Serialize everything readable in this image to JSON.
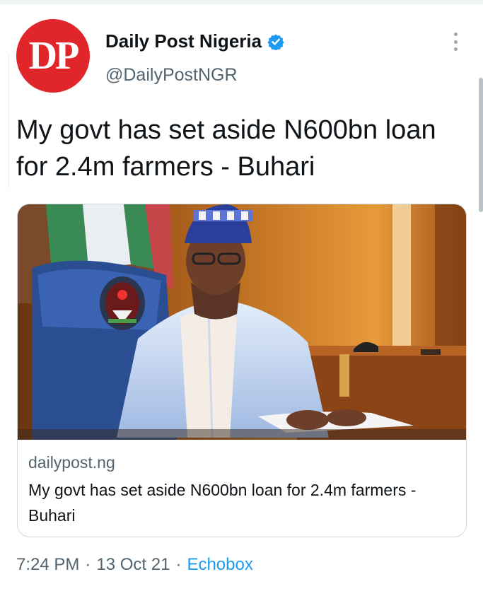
{
  "account": {
    "avatar_text": "DP",
    "display_name": "Daily Post Nigeria",
    "handle": "@DailyPostNGR",
    "verified": true
  },
  "tweet": {
    "text": "My govt has set aside N600bn loan for 2.4m farmers - Buhari"
  },
  "link_card": {
    "domain": "dailypost.ng",
    "title": "My govt has set aside N600bn loan for 2.4m farmers - Buhari",
    "image": "photo-of-man-in-blue-attire-and-cap-at-desk-beside-flag-and-blue-chair"
  },
  "meta": {
    "time": "7:24 PM",
    "separator": "·",
    "date": "13 Oct 21",
    "source": "Echobox"
  },
  "colors": {
    "avatar_bg": "#e0262a",
    "link_blue": "#1d9bf0",
    "secondary_text": "#536471"
  },
  "icons": [
    "verified-badge-icon",
    "more-options-icon"
  ]
}
